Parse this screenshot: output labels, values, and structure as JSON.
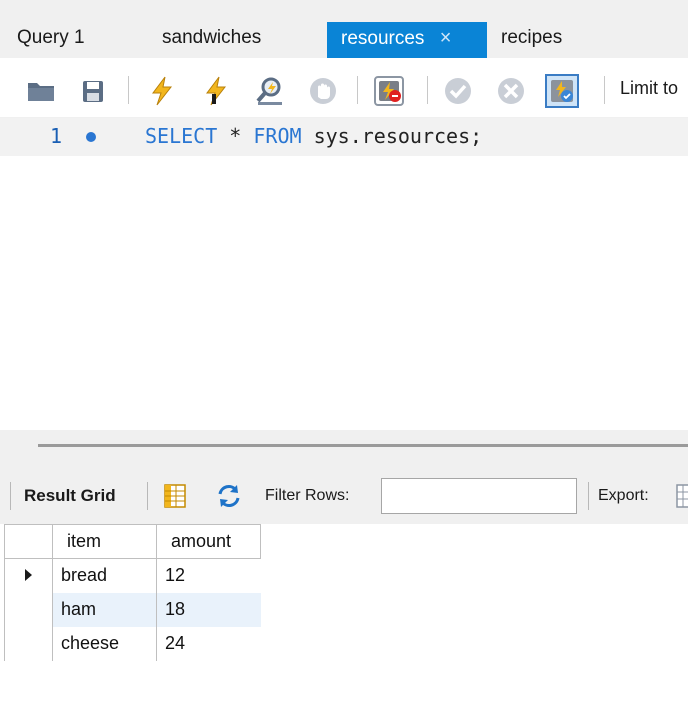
{
  "tabs": [
    {
      "label": "Query 1",
      "active": false
    },
    {
      "label": "sandwiches",
      "active": false
    },
    {
      "label": "resources",
      "active": true
    },
    {
      "label": "recipes",
      "active": false
    }
  ],
  "tab_close_glyph": "×",
  "toolbar": {
    "icons": [
      "open-folder-icon",
      "save-icon",
      "execute-icon",
      "execute-current-icon",
      "explain-icon",
      "stop-icon",
      "toggle-continue-on-error-icon",
      "commit-icon",
      "rollback-icon",
      "autocommit-icon"
    ],
    "limit_label": "Limit to"
  },
  "editor": {
    "line_number": "1",
    "code": {
      "kw1": "SELECT",
      "mid": " * ",
      "kw2": "FROM",
      "rest": " sys.resources;"
    },
    "colors": {
      "keyword": "#2a76d2",
      "line_number": "#1a5fb4"
    }
  },
  "results_toolbar": {
    "result_grid_label": "Result Grid",
    "filter_label": "Filter Rows:",
    "filter_value": "",
    "export_label": "Export:"
  },
  "grid": {
    "columns": [
      "item",
      "amount"
    ],
    "rows": [
      {
        "item": "bread",
        "amount": "12",
        "current": true
      },
      {
        "item": "ham",
        "amount": "18",
        "current": false
      },
      {
        "item": "cheese",
        "amount": "24",
        "current": false
      }
    ]
  },
  "colors": {
    "accent": "#0a84d6",
    "chrome": "#f0f0f0",
    "row_highlight": "#e9f2fb"
  }
}
